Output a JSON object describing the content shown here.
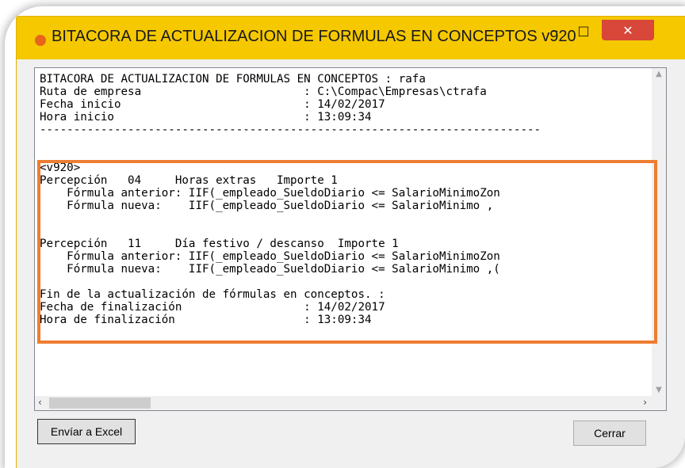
{
  "window": {
    "title": "BITACORA DE ACTUALIZACION DE FORMULAS EN CONCEPTOS v920",
    "controls": {
      "minimize": "–",
      "maximize": "□",
      "close": "✕"
    }
  },
  "log_lines": [
    "BITACORA DE ACTUALIZACION DE FORMULAS EN CONCEPTOS : rafa",
    "Ruta de empresa                        : C:\\Compac\\Empresas\\ctrafa",
    "Fecha inicio                           : 14/02/2017",
    "Hora inicio                            : 13:09:34",
    "--------------------------------------------------------------------------",
    "",
    "",
    "<v920>",
    "Percepción   04     Horas extras   Importe 1",
    "    Fórmula anterior: IIF(_empleado_SueldoDiario <= SalarioMinimoZon",
    "    Fórmula nueva:    IIF(_empleado_SueldoDiario <= SalarioMinimo ,",
    "",
    "",
    "Percepción   11     Día festivo / descanso  Importe 1",
    "    Fórmula anterior: IIF(_empleado_SueldoDiario <= SalarioMinimoZon",
    "    Fórmula nueva:    IIF(_empleado_SueldoDiario <= SalarioMinimo ,(",
    "",
    "Fin de la actualización de fórmulas en conceptos. :",
    "Fecha de finalización                  : 14/02/2017",
    "Hora de finalización                   : 13:09:34"
  ],
  "buttons": {
    "export_excel": "Envíar a Excel",
    "close": "Cerrar"
  },
  "colors": {
    "titlebar": "#f5c800",
    "highlight": "#ed7d31",
    "close_button": "#d9463a"
  },
  "icons": {
    "app": "app-icon",
    "scroll_up": "chevron-up-icon",
    "scroll_down": "chevron-down-icon",
    "scroll_left": "chevron-left-icon",
    "scroll_right": "chevron-right-icon"
  }
}
